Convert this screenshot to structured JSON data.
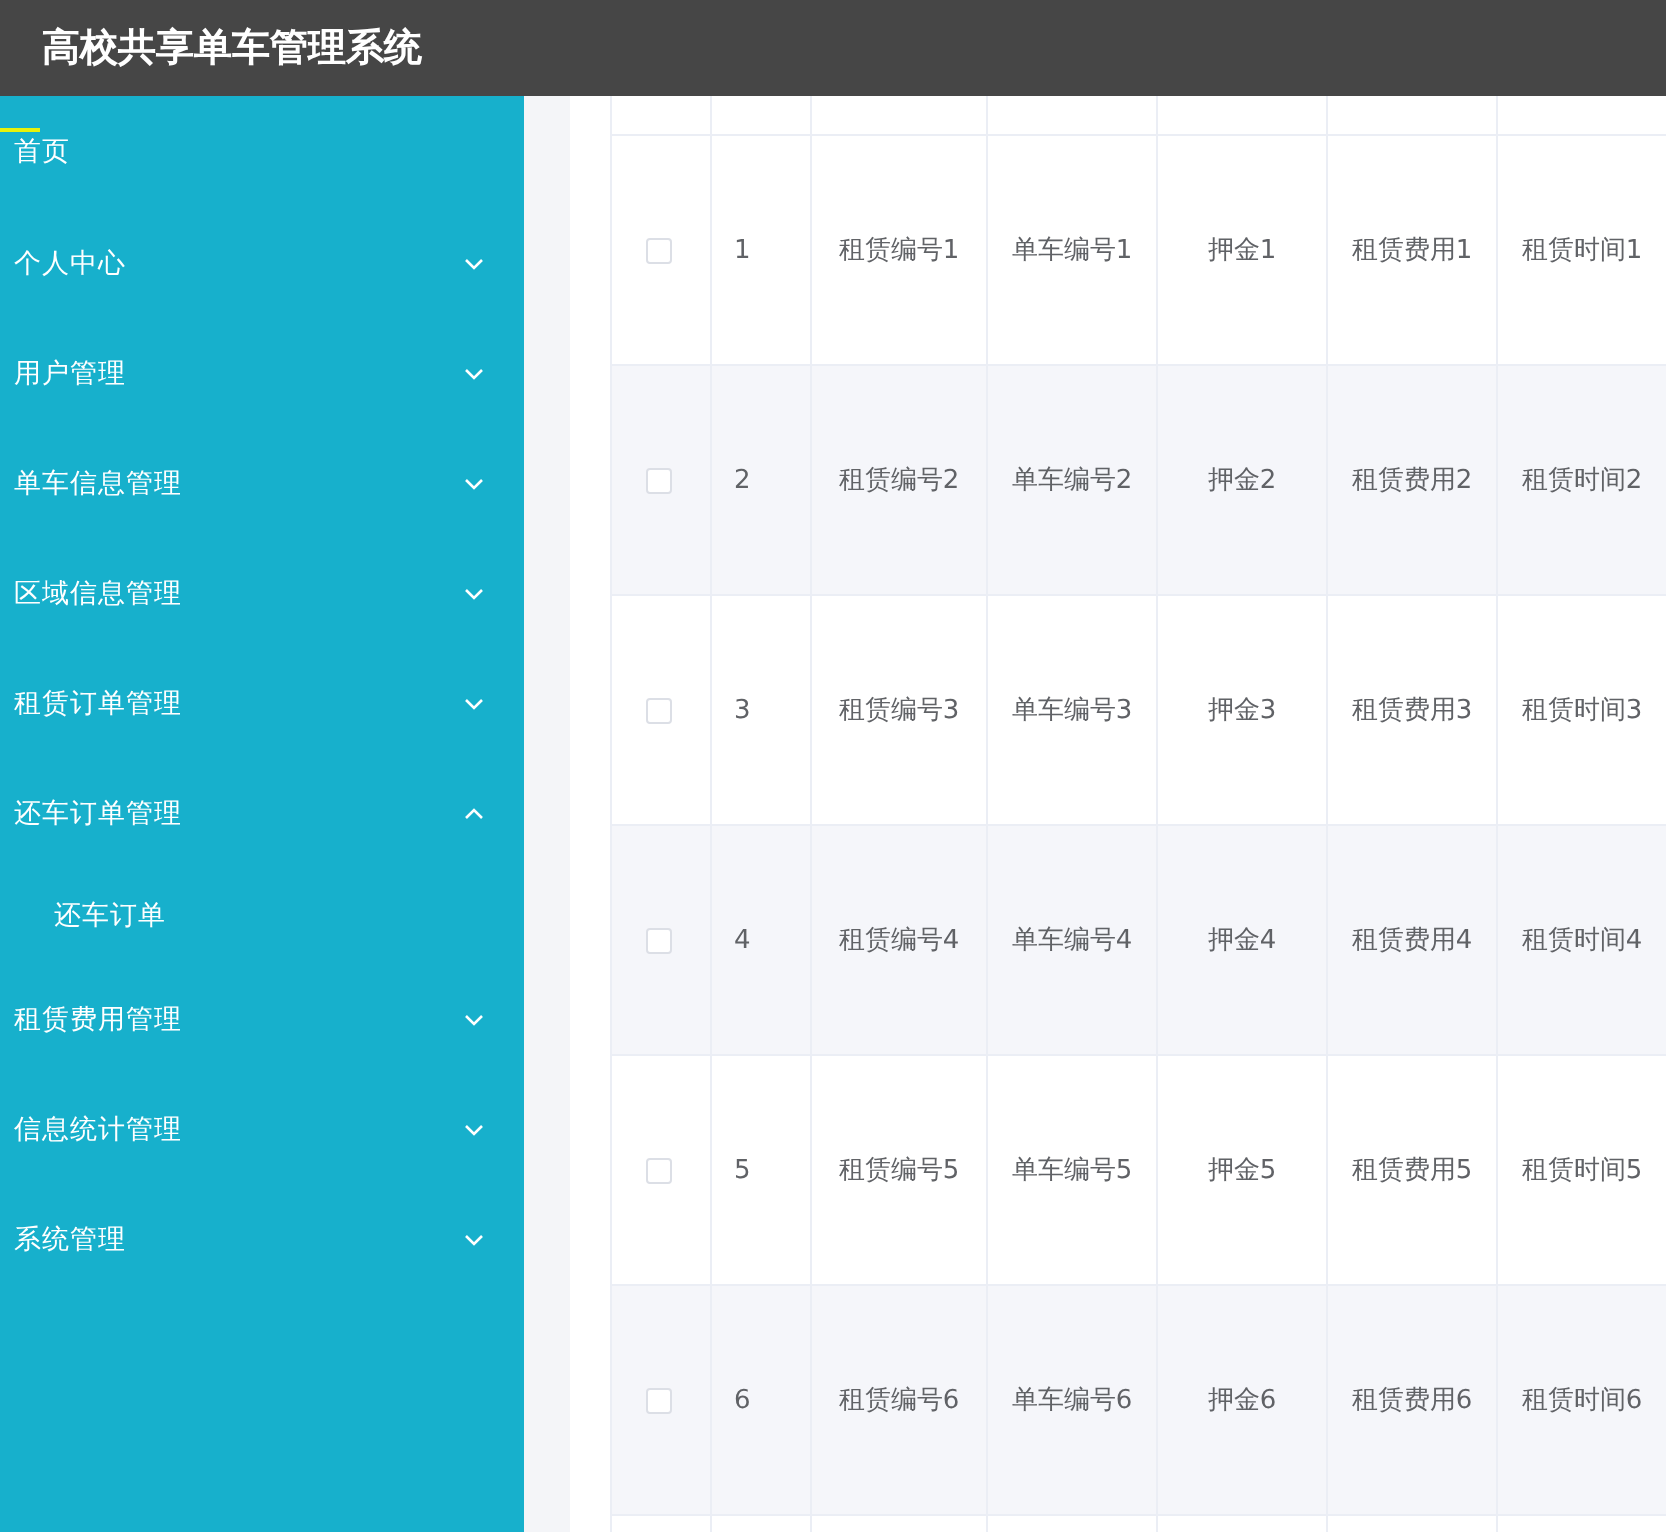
{
  "window": {
    "title": "高校共享单车管理系统"
  },
  "sidebar": {
    "items": [
      {
        "kind": "link",
        "label": "首页",
        "selected": true
      },
      {
        "kind": "group",
        "label": "个人中心",
        "selected": false,
        "expanded": false
      },
      {
        "kind": "group",
        "label": "用户管理",
        "selected": false,
        "expanded": false
      },
      {
        "kind": "group",
        "label": "单车信息管理",
        "selected": false,
        "expanded": false
      },
      {
        "kind": "group",
        "label": "区域信息管理",
        "selected": false,
        "expanded": false
      },
      {
        "kind": "group",
        "label": "租赁订单管理",
        "selected": false,
        "expanded": false
      },
      {
        "kind": "group",
        "label": "还车订单管理",
        "selected": false,
        "expanded": true,
        "children": [
          {
            "label": "还车订单",
            "selected": false
          }
        ]
      },
      {
        "kind": "group",
        "label": "租赁费用管理",
        "selected": false,
        "expanded": false
      },
      {
        "kind": "group",
        "label": "信息统计管理",
        "selected": false,
        "expanded": false
      },
      {
        "kind": "group",
        "label": "系统管理",
        "selected": false,
        "expanded": false
      }
    ]
  },
  "table": {
    "rows": [
      {
        "checked": false,
        "index": "1",
        "cells": [
          "租赁编号1",
          "单车编号1",
          "押金1",
          "租赁费用1",
          "租赁时间1"
        ]
      },
      {
        "checked": false,
        "index": "2",
        "cells": [
          "租赁编号2",
          "单车编号2",
          "押金2",
          "租赁费用2",
          "租赁时间2"
        ]
      },
      {
        "checked": false,
        "index": "3",
        "cells": [
          "租赁编号3",
          "单车编号3",
          "押金3",
          "租赁费用3",
          "租赁时间3"
        ]
      },
      {
        "checked": false,
        "index": "4",
        "cells": [
          "租赁编号4",
          "单车编号4",
          "押金4",
          "租赁费用4",
          "租赁时间4"
        ]
      },
      {
        "checked": false,
        "index": "5",
        "cells": [
          "租赁编号5",
          "单车编号5",
          "押金5",
          "租赁费用5",
          "租赁时间5"
        ]
      },
      {
        "checked": false,
        "index": "6",
        "cells": [
          "租赁编号6",
          "单车编号6",
          "押金6",
          "租赁费用6",
          "租赁时间6"
        ]
      }
    ]
  }
}
